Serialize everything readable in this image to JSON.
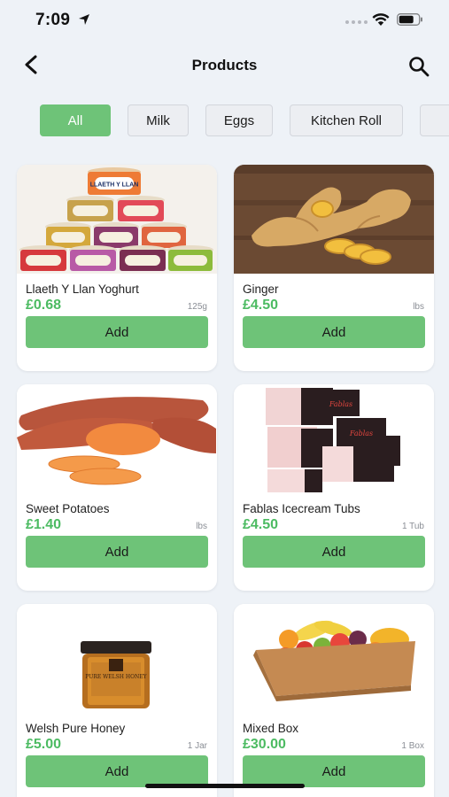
{
  "status_bar": {
    "time": "7:09"
  },
  "header": {
    "title": "Products"
  },
  "filters": [
    "All",
    "Milk",
    "Eggs",
    "Kitchen Roll"
  ],
  "products": [
    {
      "name": "Llaeth Y Llan Yoghurt",
      "price": "£0.68",
      "unit": "125g",
      "add_label": "Add",
      "image_label": "LLAETH Y LLAN"
    },
    {
      "name": "Ginger",
      "price": "£4.50",
      "unit": "lbs",
      "add_label": "Add"
    },
    {
      "name": "Sweet Potatoes",
      "price": "£1.40",
      "unit": "lbs",
      "add_label": "Add"
    },
    {
      "name": "Fablas Icecream Tubs",
      "price": "£4.50",
      "unit": "1 Tub",
      "add_label": "Add",
      "image_label": "Fablas"
    },
    {
      "name": "Welsh Pure Honey",
      "price": "£5.00",
      "unit": "1 Jar",
      "add_label": "Add",
      "image_label": "PURE WELSH HONEY"
    },
    {
      "name": "Mixed Box",
      "price": "£30.00",
      "unit": "1 Box",
      "add_label": "Add"
    }
  ],
  "colors": {
    "accent": "#6ec378",
    "price": "#4cbb62",
    "background": "#eef2f7"
  },
  "icons": [
    "location-arrow-icon",
    "wifi-icon",
    "battery-icon",
    "back-arrow-icon",
    "search-icon"
  ]
}
